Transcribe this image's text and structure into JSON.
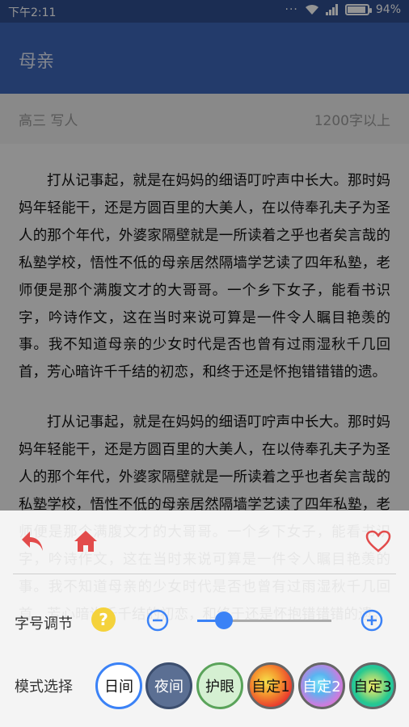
{
  "status_bar": {
    "time": "下午2:11",
    "battery": "94%",
    "battery_level": 0.94
  },
  "app_bar": {
    "title": "母亲"
  },
  "meta": {
    "grade_category": "高三  写人",
    "word_count": "1200字以上"
  },
  "article": {
    "paragraphs": [
      "打从记事起，就是在妈妈的细语叮咛声中长大。那时妈妈年轻能干，还是方圆百里的大美人，在以侍奉孔夫子为圣人的那个年代，外婆家隔壁就是一所读着之乎也者矣言哉的私塾学校，悟性不低的母亲居然隔墙学艺读了四年私塾，老师便是那个满腹文才的大哥哥。一个乡下女子，能看书识字，吟诗作文，这在当时来说可算是一件令人瞩目艳羡的事。我不知道母亲的少女时代是否也曾有过雨湿秋千几回首，芳心暗许千千结的初恋，和终于还是怀抱错错错的遗。",
      "打从记事起，就是在妈妈的细语叮咛声中长大。那时妈妈年轻能干，还是方圆百里的大美人，在以侍奉孔夫子为圣人的那个年代，外婆家隔壁就是一所读着之乎也者矣言哉的私塾学校，悟性不低的母亲居然隔墙学艺读了四年私塾，老师便是那个满腹文才的大哥哥。一个乡下女子，能看书识字，吟诗作文，这在当时来说可算是一件令人瞩目艳羡的事。我不知道母亲的少女时代是否也曾有过雨湿秋千几回首，芳心暗许千千结的初恋，和终于还是怀抱错错错的遗。"
    ]
  },
  "panel": {
    "font_size_label": "字号调节",
    "font_size_level": 0.2,
    "mode_label": "模式选择",
    "modes": [
      "日间",
      "夜间",
      "护眼",
      "自定1",
      "自定2",
      "自定3"
    ],
    "selected_mode": "日间",
    "icons": {
      "back": "back-arrow-icon",
      "home": "home-icon",
      "favorite": "heart-icon",
      "help": "help-icon",
      "minus": "minus-circle-icon",
      "plus": "plus-circle-icon"
    },
    "colors": {
      "accent": "#3b82f6",
      "icon_red": "#e24b4b",
      "header": "#3d67b8"
    }
  }
}
